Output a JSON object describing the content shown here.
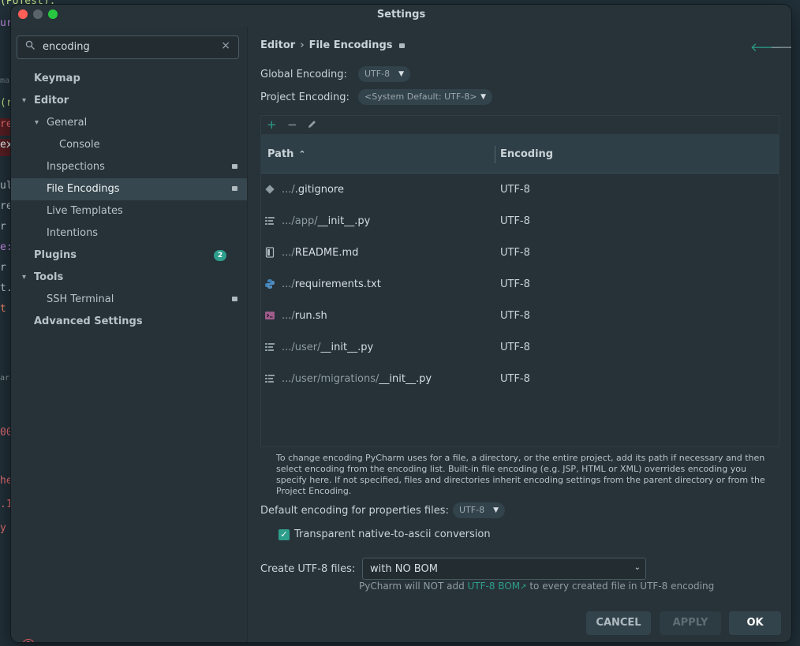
{
  "window": {
    "title": "Settings"
  },
  "background_fragments": [
    "(PUTest).",
    "ur",
    "ma",
    "(r",
    "re",
    "ex",
    "ul",
    "re",
    "r",
    "e:",
    "r",
    "t.",
    "t",
    "ari",
    "00",
    "he",
    ".1",
    "y"
  ],
  "sidebar": {
    "search": {
      "value": "encoding"
    },
    "items": [
      {
        "label": "Keymap"
      },
      {
        "label": "Editor"
      },
      {
        "label": "General"
      },
      {
        "label": "Console"
      },
      {
        "label": "Inspections"
      },
      {
        "label": "File Encodings"
      },
      {
        "label": "Live Templates"
      },
      {
        "label": "Intentions"
      },
      {
        "label": "Plugins",
        "badge": "2"
      },
      {
        "label": "Tools"
      },
      {
        "label": "SSH Terminal"
      },
      {
        "label": "Advanced Settings"
      }
    ],
    "help": "?"
  },
  "breadcrumb": {
    "parent": "Editor",
    "current": "File Encodings"
  },
  "global_encoding": {
    "label": "Global Encoding:",
    "value": "UTF-8"
  },
  "project_encoding": {
    "label": "Project Encoding:",
    "value": "<System Default: UTF-8>"
  },
  "table": {
    "col_path": "Path",
    "col_encoding": "Encoding",
    "rows": [
      {
        "dir": ".../",
        "file": ".gitignore",
        "encoding": "UTF-8",
        "icon": "git-file-icon"
      },
      {
        "dir": ".../app/",
        "file": "__init__.py",
        "encoding": "UTF-8",
        "icon": "python-init-file-icon"
      },
      {
        "dir": ".../",
        "file": "README.md",
        "encoding": "UTF-8",
        "icon": "markdown-file-icon"
      },
      {
        "dir": ".../",
        "file": "requirements.txt",
        "encoding": "UTF-8",
        "icon": "python-requirements-icon"
      },
      {
        "dir": ".../",
        "file": "run.sh",
        "encoding": "UTF-8",
        "icon": "shell-script-icon"
      },
      {
        "dir": ".../user/",
        "file": "__init__.py",
        "encoding": "UTF-8",
        "icon": "python-init-file-icon"
      },
      {
        "dir": ".../user/migrations/",
        "file": "__init__.py",
        "encoding": "UTF-8",
        "icon": "python-init-file-icon"
      }
    ]
  },
  "note": "To change encoding PyCharm uses for a file, a directory, or the entire project, add its path if necessary and then select encoding from the encoding list. Built-in file encoding (e.g. JSP, HTML or XML) overrides encoding you specify here. If not specified, files and directories inherit encoding settings from the parent directory or from the Project Encoding.",
  "properties_encoding": {
    "label": "Default encoding for properties files:",
    "value": "UTF-8"
  },
  "transparent": {
    "label": "Transparent native-to-ascii conversion",
    "checked": true
  },
  "create_utf8": {
    "label": "Create UTF-8 files:",
    "value": "with NO BOM"
  },
  "bom_hint": {
    "prefix": "PyCharm will NOT add ",
    "link": "UTF-8 BOM",
    "suffix": " to every created file in UTF-8 encoding"
  },
  "buttons": {
    "cancel": "CANCEL",
    "apply": "APPLY",
    "ok": "OK"
  },
  "colors": {
    "accent": "#2e9e8c",
    "panel": "#273339",
    "selected": "#37474f",
    "close": "#ff5f57",
    "maximize": "#28c840"
  }
}
